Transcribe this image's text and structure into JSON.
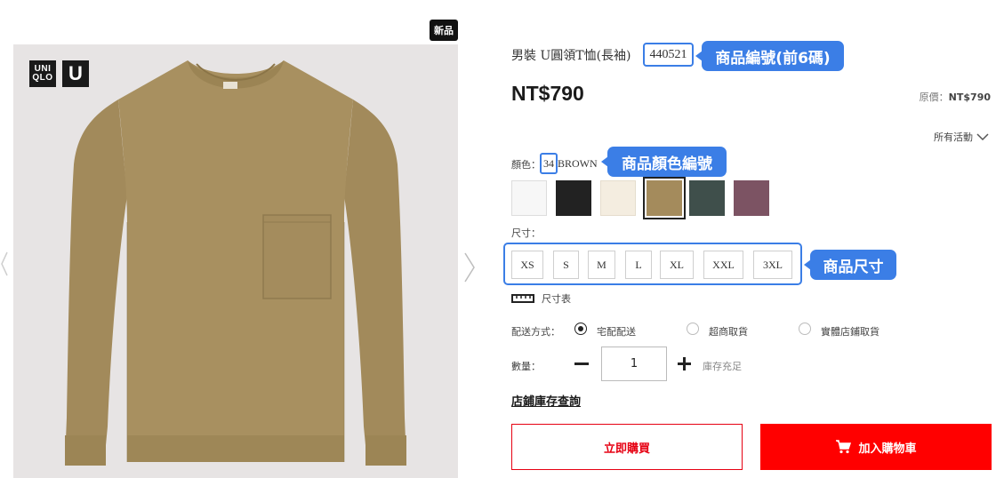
{
  "badge": {
    "new": "新品"
  },
  "brand": {
    "logo_lines": [
      "UNI",
      "QLO"
    ],
    "sub_logo": "U"
  },
  "product": {
    "title": "男裝 U圓領T恤(長袖)",
    "code": "440521",
    "price": "NT$790",
    "original_price_label": "原價：",
    "original_price": "NT$790",
    "all_events": "所有活動"
  },
  "callouts": {
    "code": "商品編號(前6碼)",
    "color": "商品顏色編號",
    "size": "商品尺寸"
  },
  "color": {
    "label": "顏色：",
    "code": "34",
    "name": "BROWN",
    "swatches": [
      {
        "name": "white",
        "hex": "#f7f7f7"
      },
      {
        "name": "black",
        "hex": "#222222"
      },
      {
        "name": "cream",
        "hex": "#f4ede0"
      },
      {
        "name": "brown",
        "hex": "#a48b5c",
        "selected": true
      },
      {
        "name": "dark-green",
        "hex": "#3f4f4b"
      },
      {
        "name": "wine",
        "hex": "#7c5363"
      }
    ]
  },
  "size": {
    "label": "尺寸：",
    "options": [
      "XS",
      "S",
      "M",
      "L",
      "XL",
      "XXL",
      "3XL"
    ],
    "chart_link": "尺寸表"
  },
  "delivery": {
    "label": "配送方式：",
    "options": [
      {
        "label": "宅配配送",
        "checked": true
      },
      {
        "label": "超商取貨",
        "checked": false
      },
      {
        "label": "實體店鋪取貨",
        "checked": false
      }
    ]
  },
  "quantity": {
    "label": "數量：",
    "value": "1",
    "stock": "庫存充足"
  },
  "store_stock_link": "店鋪庫存查詢",
  "buttons": {
    "buy_now": "立即購買",
    "add_to_cart": "加入購物車"
  },
  "colors": {
    "accent_blue": "#3b7ee6",
    "brand_red": "#ff0000",
    "image_bg": "#e7e4e4"
  }
}
